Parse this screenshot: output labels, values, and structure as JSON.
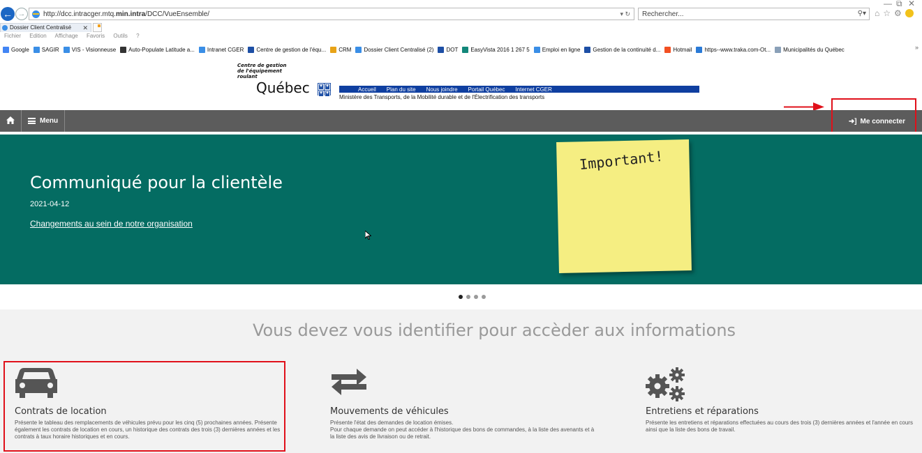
{
  "browser": {
    "url_prefix": "http://dcc.intracger.mtq.",
    "url_bold": "min.intra",
    "url_suffix": "/DCC/VueEnsemble/",
    "search_placeholder": "Rechercher...",
    "tab_title": "Dossier Client Centralisé",
    "menu": [
      "Fichier",
      "Edition",
      "Affichage",
      "Favoris",
      "Outils",
      "?"
    ],
    "favorites": [
      {
        "label": "Google",
        "color": "#4285f4"
      },
      {
        "label": "SAGIR",
        "color": "#3a8ee6"
      },
      {
        "label": "VIS - Visionneuse",
        "color": "#3a8ee6"
      },
      {
        "label": "Auto-Populate Latitude a...",
        "color": "#333333"
      },
      {
        "label": "Intranet CGER",
        "color": "#3a8ee6"
      },
      {
        "label": "Centre de gestion de l'équ...",
        "color": "#1d4fa5"
      },
      {
        "label": "CRM",
        "color": "#e8a317"
      },
      {
        "label": "Dossier Client Centralisé (2)",
        "color": "#3a8ee6"
      },
      {
        "label": "DOT",
        "color": "#1d4fa5"
      },
      {
        "label": "EasyVista 2016 1 267 5",
        "color": "#13877a"
      },
      {
        "label": "Emploi en ligne",
        "color": "#3a8ee6"
      },
      {
        "label": "Gestion de la continuité d...",
        "color": "#1d4fa5"
      },
      {
        "label": "Hotmail",
        "color": "#f25022"
      },
      {
        "label": "https--www.traka.com-Ot...",
        "color": "#2a7ad6"
      },
      {
        "label": "Municipalités du Québec",
        "color": "#8aa0b8"
      }
    ]
  },
  "header": {
    "logo_line1": "Centre de gestion",
    "logo_line2": "de l'équipement",
    "logo_line3": "roulant",
    "logo_quebec": "Québec",
    "links": [
      "Accueil",
      "Plan du site",
      "Nous joindre",
      "Portail Québec",
      "Internet CGER"
    ],
    "ministry": "Ministère des Transports, de la Mobilité durable et de l'Électrification des transports"
  },
  "navbar": {
    "menu_label": "Menu",
    "connect_label": "Me connecter",
    "color": "#5c5c5c"
  },
  "hero": {
    "title": "Communiqué pour la clientèle",
    "date": "2021-04-12",
    "link": "Changements au sein de notre organisation",
    "note": "Important!",
    "color": "#046c62",
    "slides": 4,
    "active_slide": 1
  },
  "content": {
    "identify": "Vous devez vous identifier pour accèder aux informations",
    "cards": [
      {
        "icon": "car-icon",
        "title": "Contrats de location",
        "desc": "Présente le tableau des remplacements de véhicules prévu pour les cinq (5) prochaines années. Présente également les contrats de location en cours, un historique des contrats des trois (3) dernières années et les contrats à taux horaire historiques et en cours."
      },
      {
        "icon": "exchange-arrows-icon",
        "title": "Mouvements de véhicules",
        "desc": "Présente l'état des demandes de location émises.\nPour chaque demande on peut accéder à l'historique des bons de commandes, à la liste des avenants et à la liste des avis de livraison ou de retrait."
      },
      {
        "icon": "gears-icon",
        "title": "Entretiens et réparations",
        "desc": "Présente les entretiens et réparations effectuées au cours des trois (3) dernières années et l'année en cours ainsi que la liste des bons de travail."
      }
    ]
  }
}
